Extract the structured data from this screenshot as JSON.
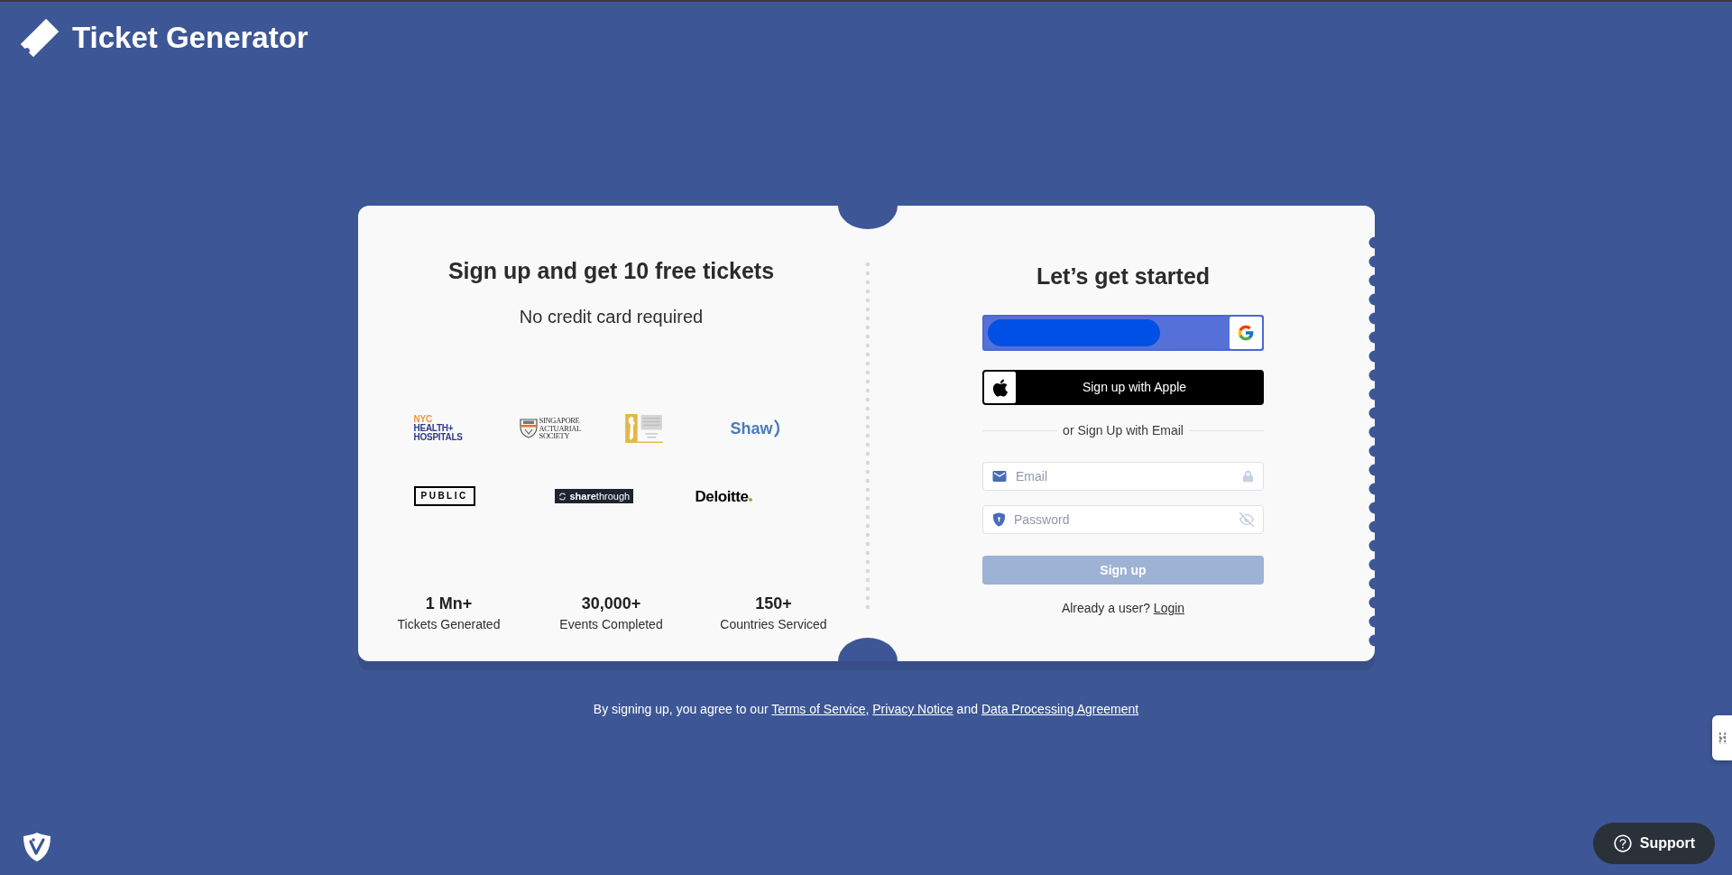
{
  "header": {
    "title": "Ticket Generator"
  },
  "promo": {
    "title": "Sign up and get 10 free tickets",
    "subtitle": "No credit card required",
    "logo_rows": [
      [
        {
          "kind": "stacked",
          "lines": [
            "NYC",
            "HEALTH+",
            "HOSPITALS"
          ]
        },
        {
          "kind": "crest",
          "lines": [
            "SINGAPORE",
            "ACTUARIAL",
            "SOCIETY"
          ]
        },
        {
          "kind": "emblem"
        },
        {
          "kind": "arc",
          "text": "Shaw"
        }
      ],
      [
        {
          "kind": "boxed",
          "text": "PUBLIC"
        },
        {
          "kind": "badge",
          "text": "**share**through"
        },
        {
          "kind": "dot",
          "text": "Deloitte"
        }
      ]
    ],
    "stats": [
      {
        "value": "1 Mn+",
        "label": "Tickets Generated"
      },
      {
        "value": "30,000+",
        "label": "Events Completed"
      },
      {
        "value": "150+",
        "label": "Countries Serviced"
      }
    ]
  },
  "signup": {
    "title": "Let’s get started",
    "social_buttons": [
      {
        "kind": "google"
      },
      {
        "kind": "apple",
        "label": "Sign up with Apple"
      }
    ],
    "divider": "or Sign Up with Email",
    "fields": [
      {
        "kind": "email",
        "placeholder": "Email"
      },
      {
        "kind": "password",
        "placeholder": "Password"
      }
    ],
    "submit": {
      "label": "Sign up",
      "disabled": true
    },
    "login_prompt": {
      "text": "Already a user?",
      "link": "Login"
    }
  },
  "footer": {
    "parts": [
      {
        "kind": "text",
        "text": "By signing up, you agree to our "
      },
      {
        "kind": "link",
        "text": "Terms of Service"
      },
      {
        "kind": "text",
        "text": ", "
      },
      {
        "kind": "link",
        "text": "Privacy Notice"
      },
      {
        "kind": "text",
        "text": " and "
      },
      {
        "kind": "link",
        "text": "Data Processing Agreement"
      }
    ]
  },
  "support": {
    "label": "Support"
  }
}
